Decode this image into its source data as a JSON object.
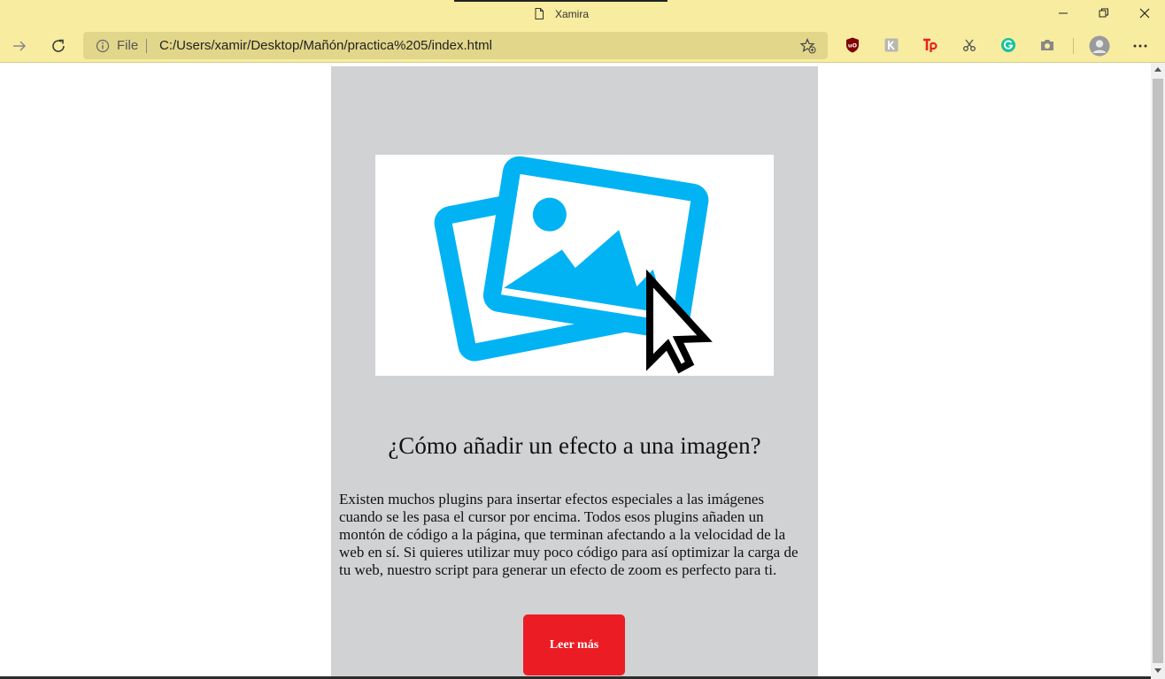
{
  "window": {
    "title": "Xamira",
    "minimize_icon": "minimize-icon",
    "restore_icon": "restore-icon",
    "close_icon": "close-icon"
  },
  "toolbar": {
    "forward_icon": "forward-arrow-icon",
    "reload_icon": "reload-icon",
    "address": {
      "scheme_label": "File",
      "url": "C:/Users/xamir/Desktop/Mañón/practica%205/index.html",
      "info_icon": "info-icon",
      "favorite_icon": "add-favorite-icon"
    },
    "extensions": [
      {
        "name": "ublock-icon",
        "color": "#800000"
      },
      {
        "name": "ext-k-icon",
        "color": "#9e9e9e"
      },
      {
        "name": "tp-icon",
        "color": "#e8231e"
      },
      {
        "name": "scissors-icon",
        "color": "#555555"
      },
      {
        "name": "grammarly-icon",
        "color": "#15c39a"
      },
      {
        "name": "camera-icon",
        "color": "#777777"
      }
    ],
    "profile_icon": "profile-avatar-icon",
    "menu_icon": "more-menu-icon"
  },
  "page": {
    "card_bg": "#d1d2d4",
    "image_icon": "image-gallery-icon",
    "image_color": "#02b3f4",
    "heading": "¿Cómo añadir un efecto a una imagen?",
    "body": "Existen muchos plugins para insertar efectos especiales a las imágenes cuando se les pasa el cursor por encima. Todos esos plugins añaden un montón de código a la página, que terminan afectando a la velocidad de la web en sí. Si quieres utilizar muy poco código para así optimizar la carga de tu web, nuestro script para generar un efecto de zoom es perfecto para ti.",
    "button_label": "Leer más",
    "button_color": "#ec1c24"
  }
}
